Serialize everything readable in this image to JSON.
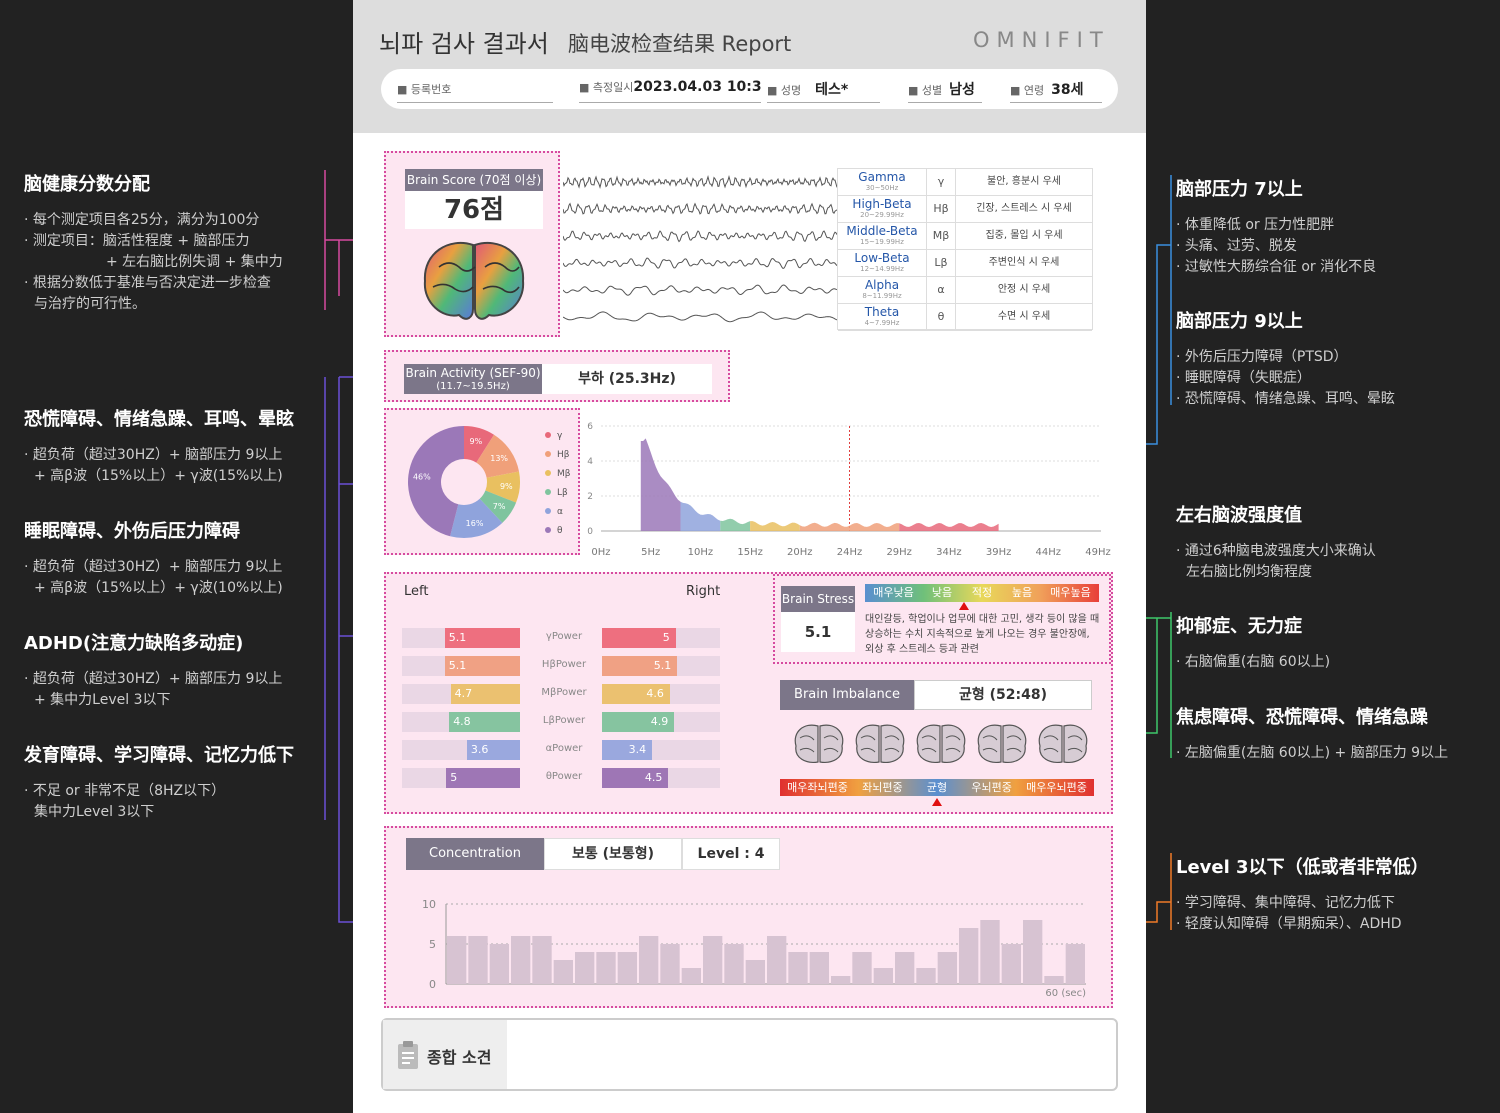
{
  "left_panel": [
    {
      "title": "脑健康分数分配",
      "lines": [
        "· 每个测定项目各25分，满分为100分",
        "· 测定项目：脑活性程度 + 脑部压力",
        "  + 左右脑比例失调 + 集中力",
        "· 根据分数低于基准与否决定进一步检查",
        "  与治疗的可行性。"
      ]
    },
    {
      "title": "恐慌障碍、情绪急躁、耳鸣、晕眩",
      "lines": [
        "· 超负荷（超过30HZ）+ 脑部压力 9以上",
        "  + 高β波（15%以上）+ γ波(15%以上)"
      ]
    },
    {
      "title": "睡眠障碍、外伤后压力障碍",
      "lines": [
        "· 超负荷（超过30HZ）+ 脑部压力 9以上",
        "  + 高β波（15%以上）+ γ波(10%以上)"
      ]
    },
    {
      "title": "ADHD(注意力缺陷多动症)",
      "lines": [
        "· 超负荷（超过30HZ）+ 脑部压力 9以上",
        "  + 集中力Level 3以下"
      ]
    },
    {
      "title": "发育障碍、学习障碍、记忆力低下",
      "lines": [
        "· 不足 or 非常不足（8HZ以下）",
        "  集中力Level 3以下"
      ]
    }
  ],
  "right_panel": [
    {
      "title": "脑部压力 7以上",
      "lines": [
        "· 体重降低 or 压力性肥胖",
        "· 头痛、过劳、脱发",
        "· 过敏性大肠综合征 or 消化不良"
      ]
    },
    {
      "title": "脑部压力 9以上",
      "lines": [
        "· 外伤后压力障碍（PTSD）",
        "· 睡眠障碍（失眠症）",
        "· 恐慌障碍、情绪急躁、耳鸣、晕眩"
      ]
    },
    {
      "title": "左右脑波强度值",
      "lines": [
        "· 通过6种脑电波强度大小来确认",
        "  左右脑比例均衡程度"
      ]
    },
    {
      "title": "抑郁症、无力症",
      "lines": [
        "· 右脑偏重(右脑 60以上)"
      ]
    },
    {
      "title": "焦虑障碍、恐慌障碍、情绪急躁",
      "lines": [
        "· 左脑偏重(左脑 60以上) + 脑部压力 9以上"
      ]
    },
    {
      "title": "Level 3以下（低或者非常低）",
      "lines": [
        "· 学习障碍、集中障碍、记忆力低下",
        "· 轻度认知障碍（早期痴呆）、ADHD"
      ]
    }
  ],
  "report": {
    "title_kr": "뇌파 검사 결과서",
    "title_cn": "脑电波检查结果 Report",
    "brand": "OMNIFIT",
    "fields": {
      "reg_label": "등록번호",
      "reg_value": "",
      "date_label": "측정일시",
      "date_value": "2023.04.03 10:3",
      "name_label": "성명",
      "name_value": "테스*",
      "sex_label": "성별",
      "sex_value": "남성",
      "age_label": "연령",
      "age_value": "38세"
    },
    "score_label": "Brain Score (70점 이상)",
    "score_value": "76점",
    "waves": [
      {
        "name": "Gamma",
        "range": "30~50Hz",
        "sym": "γ",
        "desc": "불안, 흥분시 우세"
      },
      {
        "name": "High-Beta",
        "range": "20~29.99Hz",
        "sym": "Hβ",
        "desc": "긴장, 스트레스 시 우세"
      },
      {
        "name": "Middle-Beta",
        "range": "15~19.99Hz",
        "sym": "Mβ",
        "desc": "집중, 몰입 시 우세"
      },
      {
        "name": "Low-Beta",
        "range": "12~14.99Hz",
        "sym": "Lβ",
        "desc": "주변인식 시 우세"
      },
      {
        "name": "Alpha",
        "range": "8~11.99Hz",
        "sym": "α",
        "desc": "안정 시 우세"
      },
      {
        "name": "Theta",
        "range": "4~7.99Hz",
        "sym": "θ",
        "desc": "수면 시 우세"
      }
    ],
    "activity_label": "Brain Activity (SEF-90)",
    "activity_sub": "(11.7~19.5Hz)",
    "activity_value": "부하 (25.3Hz)",
    "donut": {
      "legend": [
        "γ",
        "Hβ",
        "Mβ",
        "Lβ",
        "α",
        "θ"
      ],
      "values": [
        9,
        13,
        9,
        7,
        16,
        46
      ],
      "labels": [
        "9%",
        "13%",
        "9%",
        "7%",
        "16%",
        "46%"
      ],
      "colors": [
        "#e8697a",
        "#f0a07a",
        "#e9c060",
        "#7fc49e",
        "#8fa3dc",
        "#9b78b8"
      ]
    },
    "spectrum": {
      "ticks": [
        "0Hz",
        "5Hz",
        "10Hz",
        "15Hz",
        "20Hz",
        "24Hz",
        "29Hz",
        "34Hz",
        "39Hz",
        "44Hz",
        "49Hz"
      ],
      "y_ticks": [
        "0",
        "2",
        "4",
        "6"
      ]
    },
    "power": {
      "left_label": "Left",
      "right_label": "Right",
      "rows": [
        {
          "name": "γPower",
          "left": "5.1",
          "right": "5",
          "color": "#ee6f7f"
        },
        {
          "name": "HβPower",
          "left": "5.1",
          "right": "5.1",
          "color": "#f0a184"
        },
        {
          "name": "MβPower",
          "left": "4.7",
          "right": "4.6",
          "color": "#ebc170"
        },
        {
          "name": "LβPower",
          "left": "4.8",
          "right": "4.9",
          "color": "#86c4a0"
        },
        {
          "name": "αPower",
          "left": "3.6",
          "right": "3.4",
          "color": "#9aa8de"
        },
        {
          "name": "θPower",
          "left": "5",
          "right": "4.5",
          "color": "#9e76b5"
        }
      ]
    },
    "stress": {
      "label": "Brain Stress",
      "value": "5.1",
      "scale": [
        "매우낮음",
        "낮음",
        "적정",
        "높음",
        "매우높음"
      ],
      "desc": [
        "대인갈등, 학업이나 업무에 대한 고민, 생각 등이 많을 때",
        "상승하는 수치 지속적으로 높게 나오는 경우 불안장애,",
        "외상 후 스트레스 등과 관련"
      ]
    },
    "imbalance": {
      "label": "Brain Imbalance",
      "value": "균형 (52:48)",
      "scale": [
        "매우좌뇌편중",
        "좌뇌편중",
        "균형",
        "우뇌편중",
        "매우우뇌편중"
      ]
    },
    "concentration": {
      "label": "Concentration",
      "value": "보통 (보통형)",
      "level": "Level : 4",
      "y_ticks": [
        "10",
        "5",
        "0"
      ],
      "x_end": "60 (sec)",
      "bars": [
        6,
        6,
        5,
        6,
        6,
        3,
        4,
        4,
        4,
        6,
        5,
        2,
        6,
        5,
        3,
        6,
        4,
        4,
        1,
        4,
        2,
        4,
        2,
        4,
        7,
        8,
        5,
        8,
        1,
        5
      ]
    },
    "summary_label": "종합 소견"
  }
}
